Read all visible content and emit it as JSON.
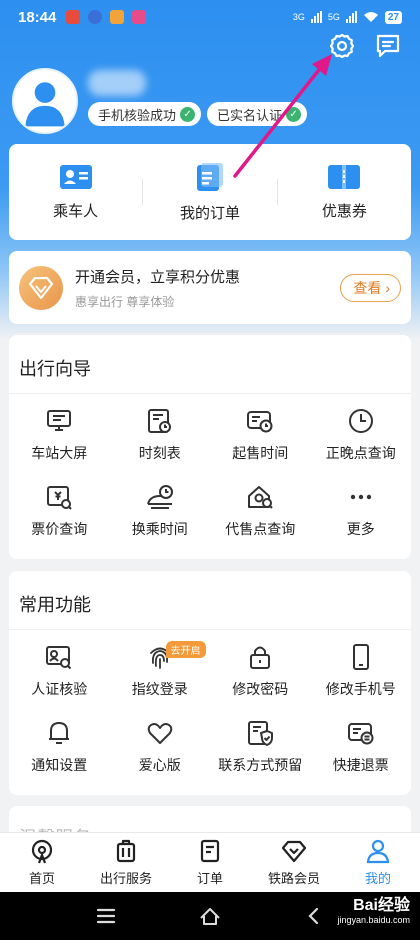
{
  "status_bar": {
    "time": "18:44",
    "network1": "3G",
    "network2": "5G",
    "battery": "27"
  },
  "profile": {
    "badges": [
      {
        "label": "手机核验成功"
      },
      {
        "label": "已实名认证"
      }
    ]
  },
  "quick_links": [
    {
      "label": "乘车人",
      "icon": "passenger-card-icon"
    },
    {
      "label": "我的订单",
      "icon": "order-document-icon"
    },
    {
      "label": "优惠券",
      "icon": "coupon-icon"
    }
  ],
  "membership": {
    "title": "开通会员，立享积分优惠",
    "subtitle": "惠享出行 尊享体验",
    "button": "查看"
  },
  "travel_guide": {
    "title": "出行向导",
    "items": [
      {
        "label": "车站大屏",
        "icon": "station-screen-icon"
      },
      {
        "label": "时刻表",
        "icon": "timetable-icon"
      },
      {
        "label": "起售时间",
        "icon": "sale-time-icon"
      },
      {
        "label": "正晚点查询",
        "icon": "clock-icon"
      },
      {
        "label": "票价查询",
        "icon": "fare-query-icon"
      },
      {
        "label": "换乘时间",
        "icon": "transfer-time-icon"
      },
      {
        "label": "代售点查询",
        "icon": "agency-search-icon"
      },
      {
        "label": "更多",
        "icon": "more-dots-icon"
      }
    ]
  },
  "common_functions": {
    "title": "常用功能",
    "items": [
      {
        "label": "人证核验",
        "icon": "id-verify-icon"
      },
      {
        "label": "指纹登录",
        "icon": "fingerprint-icon",
        "tag": "去开启"
      },
      {
        "label": "修改密码",
        "icon": "lock-icon"
      },
      {
        "label": "修改手机号",
        "icon": "phone-icon"
      },
      {
        "label": "通知设置",
        "icon": "bell-icon"
      },
      {
        "label": "爱心版",
        "icon": "heart-icon"
      },
      {
        "label": "联系方式预留",
        "icon": "contact-shield-icon"
      },
      {
        "label": "快捷退票",
        "icon": "refund-ticket-icon"
      }
    ]
  },
  "next_section": {
    "title": "温馨服务"
  },
  "tab_bar": [
    {
      "label": "首页",
      "icon": "home-train-icon"
    },
    {
      "label": "出行服务",
      "icon": "luggage-icon"
    },
    {
      "label": "订单",
      "icon": "order-icon"
    },
    {
      "label": "铁路会员",
      "icon": "diamond-icon"
    },
    {
      "label": "我的",
      "icon": "user-icon",
      "active": true
    }
  ],
  "watermark": {
    "brand": "Bai经验",
    "url": "jingyan.baidu.com"
  },
  "colors": {
    "primary": "#2d8ff0",
    "accent_orange": "#e07b23",
    "check_green": "#3cb371",
    "annotation_arrow": "#e0198a"
  }
}
